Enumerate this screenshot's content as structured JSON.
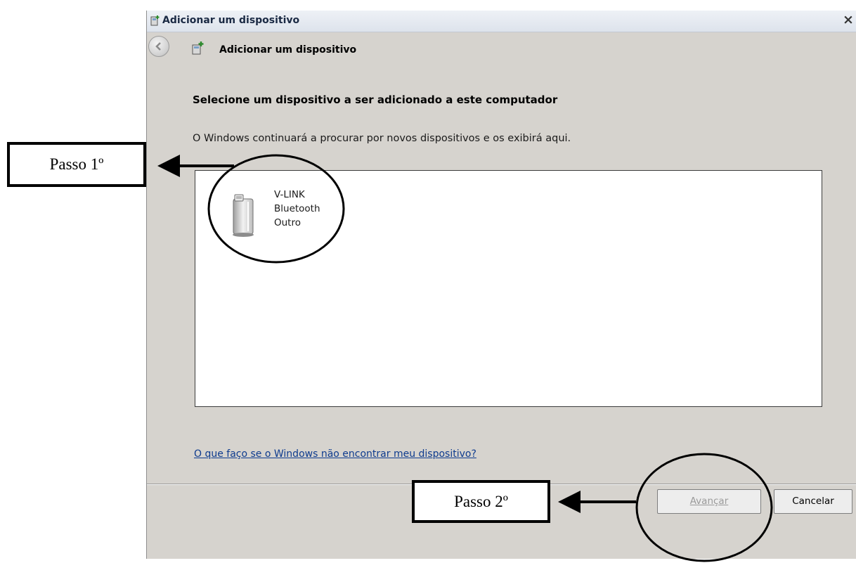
{
  "window": {
    "title": "Adicionar um dispositivo",
    "close_label": "×"
  },
  "nav": {
    "title": "Adicionar um dispositivo"
  },
  "content": {
    "heading": "Selecione um dispositivo a ser adicionado a este computador",
    "subtext": "O Windows continuará a procurar por novos dispositivos e os exibirá aqui.",
    "devices": [
      {
        "icon": "bluetooth-device-icon",
        "lines": [
          "V-LINK",
          "Bluetooth",
          "Outro"
        ]
      }
    ],
    "help_link": "O que faço se o Windows não encontrar meu dispositivo?"
  },
  "buttons": {
    "next": "Avançar",
    "cancel": "Cancelar"
  },
  "annotations": {
    "step1": "Passo 1º",
    "step2": "Passo 2º"
  },
  "colors": {
    "window_bg": "#d6d3ce",
    "link": "#0e3b8e",
    "disabled_text": "#9a9a9a"
  }
}
